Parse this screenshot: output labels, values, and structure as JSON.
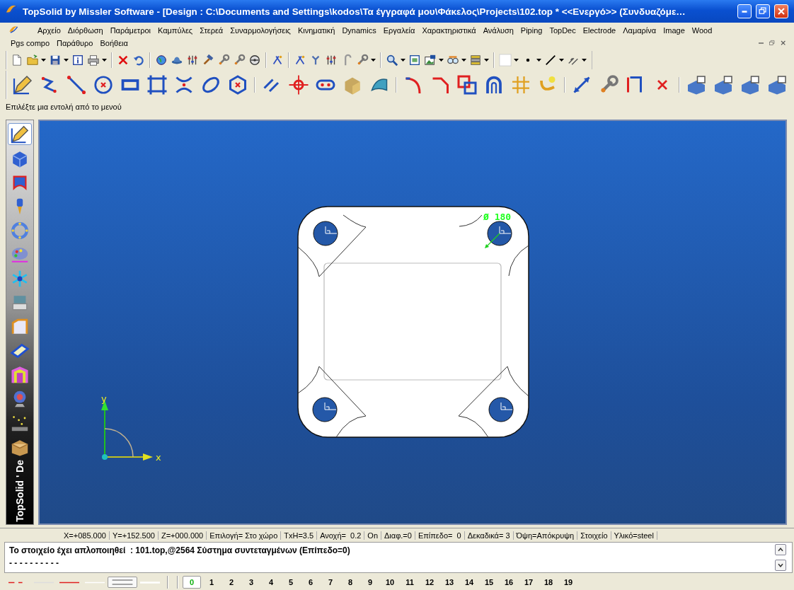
{
  "window": {
    "title": "TopSolid by Missler Software - [Design : C:\\Documents and Settings\\kodos\\Τα έγγραφά μου\\Φάκελος\\Projects\\102.top *  <<Ενεργό>> (Συνδυαζόμε…"
  },
  "menu": {
    "rows": [
      [
        "Αρχείο",
        "Διόρθωση",
        "Παράμετροι",
        "Καμπύλες",
        "Στερεά",
        "Συναρμολογήσεις",
        "Κινηματική",
        "Dynamics",
        "Εργαλεία",
        "Χαρακτηριστικά",
        "Ανάλυση",
        "Piping",
        "TopDec",
        "Electrode",
        "Λαμαρίνα",
        "Image",
        "Wood"
      ],
      [
        "Pgs compo",
        "Παράθυρο",
        "Βοήθεια"
      ]
    ]
  },
  "prompt": "Επιλέξτε μια εντολή από το μενού",
  "palette": {
    "label": "TopSolid ' De",
    "items": [
      {
        "kind": "pencil",
        "selected": true
      },
      {
        "kind": "cube",
        "selected": false
      },
      {
        "kind": "surface",
        "selected": false
      },
      {
        "kind": "drill",
        "selected": false
      },
      {
        "kind": "ring",
        "selected": false
      },
      {
        "kind": "paint",
        "selected": false
      },
      {
        "kind": "star",
        "selected": false
      },
      {
        "kind": "machine",
        "selected": false
      },
      {
        "kind": "bend",
        "selected": false
      },
      {
        "kind": "plate",
        "selected": false
      },
      {
        "kind": "bracket",
        "selected": false
      },
      {
        "kind": "globe",
        "selected": false
      },
      {
        "kind": "scatter",
        "selected": false
      },
      {
        "kind": "box",
        "selected": false
      }
    ]
  },
  "viewport": {
    "dimension": "Ø 180",
    "x_axis": "x",
    "y_axis": "y"
  },
  "coordinates": [
    "X=+085.000",
    "Y=+152.500",
    "Z=+000.000",
    "Επιλογή= Στο χώρο",
    "TxH=3.5",
    "Ανοχή=  0.2",
    "On",
    "Διαφ.=0",
    "Επίπεδο=  0",
    "Δεκαδικά= 3",
    "Όψη=Απόκρυψη",
    "Στοιχείο",
    "Υλικό=steel"
  ],
  "messages": [
    "Το στοιχείο έχει απλοποιηθεί  : 101.top,@2564 Σύστημα συντεταγμένων (Επίπεδο=0)",
    "- - - - - - - - - -"
  ],
  "layers": [
    {
      "label": "0",
      "selected": true
    },
    {
      "label": "1",
      "selected": false
    },
    {
      "label": "2",
      "selected": false
    },
    {
      "label": "3",
      "selected": false
    },
    {
      "label": "4",
      "selected": false
    },
    {
      "label": "5",
      "selected": false
    },
    {
      "label": "6",
      "selected": false
    },
    {
      "label": "7",
      "selected": false
    },
    {
      "label": "8",
      "selected": false
    },
    {
      "label": "9",
      "selected": false
    },
    {
      "label": "10",
      "selected": false
    },
    {
      "label": "11",
      "selected": false
    },
    {
      "label": "12",
      "selected": false
    },
    {
      "label": "13",
      "selected": false
    },
    {
      "label": "14",
      "selected": false
    },
    {
      "label": "15",
      "selected": false
    },
    {
      "label": "16",
      "selected": false
    },
    {
      "label": "17",
      "selected": false
    },
    {
      "label": "18",
      "selected": false
    },
    {
      "label": "19",
      "selected": false
    }
  ]
}
